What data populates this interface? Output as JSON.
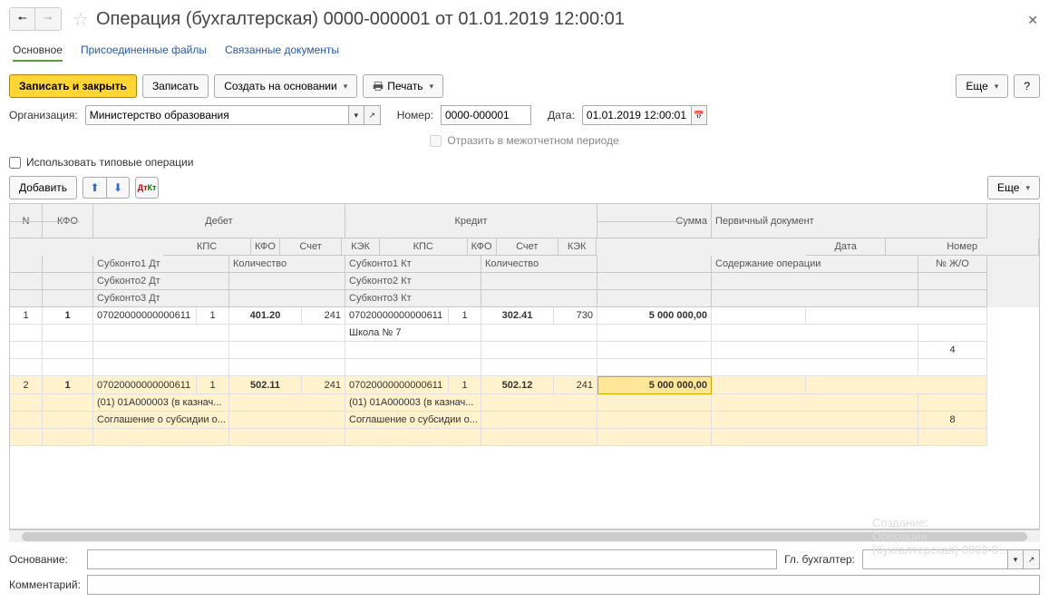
{
  "header": {
    "title": "Операция (бухгалтерская) 0000-000001 от 01.01.2019 12:00:01"
  },
  "tabs": {
    "main": "Основное",
    "files": "Присоединенные файлы",
    "linked": "Связанные документы"
  },
  "toolbar": {
    "save_close": "Записать и закрыть",
    "save": "Записать",
    "create_based": "Создать на основании",
    "print": "Печать",
    "more": "Еще",
    "help": "?"
  },
  "form": {
    "org_label": "Организация:",
    "org_value": "Министерство образования",
    "num_label": "Номер:",
    "num_value": "0000-000001",
    "date_label": "Дата:",
    "date_value": "01.01.2019 12:00:01",
    "interperiod": "Отразить в межотчетном периоде",
    "use_typical": "Использовать типовые операции"
  },
  "subtoolbar": {
    "add": "Добавить",
    "more": "Еще"
  },
  "grid_headers": {
    "n": "N",
    "kfo": "КФО",
    "debit": "Дебет",
    "credit": "Кредит",
    "sum": "Сумма",
    "primary_doc": "Первичный документ",
    "kps": "КПС",
    "kfo2": "КФО",
    "acc": "Счет",
    "kek": "КЭК",
    "date": "Дата",
    "num": "Номер",
    "sub1d": "Субконто1 Дт",
    "sub2d": "Субконто2 Дт",
    "sub3d": "Субконто3 Дт",
    "qty": "Количество",
    "sub1k": "Субконто1 Кт",
    "sub2k": "Субконто2 Кт",
    "sub3k": "Субконто3 Кт",
    "content": "Содержание операции",
    "njo": "№ Ж/О"
  },
  "rows": [
    {
      "n": "1",
      "kfo": "1",
      "d_kps": "07020000000000611",
      "d_kfo": "1",
      "d_acc": "401.20",
      "d_kek": "241",
      "k_kps": "07020000000000611",
      "k_kfo": "1",
      "k_acc": "302.41",
      "k_kek": "730",
      "sum": "5 000 000,00",
      "k_sub1": "Школа № 7",
      "njo": "4"
    },
    {
      "n": "2",
      "kfo": "1",
      "d_kps": "07020000000000611",
      "d_kfo": "1",
      "d_acc": "502.11",
      "d_kek": "241",
      "k_kps": "07020000000000611",
      "k_kfo": "1",
      "k_acc": "502.12",
      "k_kek": "241",
      "sum": "5 000 000,00",
      "d_sub1": "(01) 01А000003 (в казнач...",
      "d_sub2": "Соглашение о субсидии о...",
      "k_sub1": "(01) 01А000003 (в казнач...",
      "k_sub2": "Соглашение о субсидии о...",
      "njo": "8"
    }
  ],
  "bottom": {
    "basis_label": "Основание:",
    "chief_label": "Гл. бухгалтер:",
    "comment_label": "Комментарий:"
  },
  "ghost": {
    "l1": "Создание:",
    "l2": "Операция",
    "l3": "(бухгалтерская) 0000-0..."
  }
}
